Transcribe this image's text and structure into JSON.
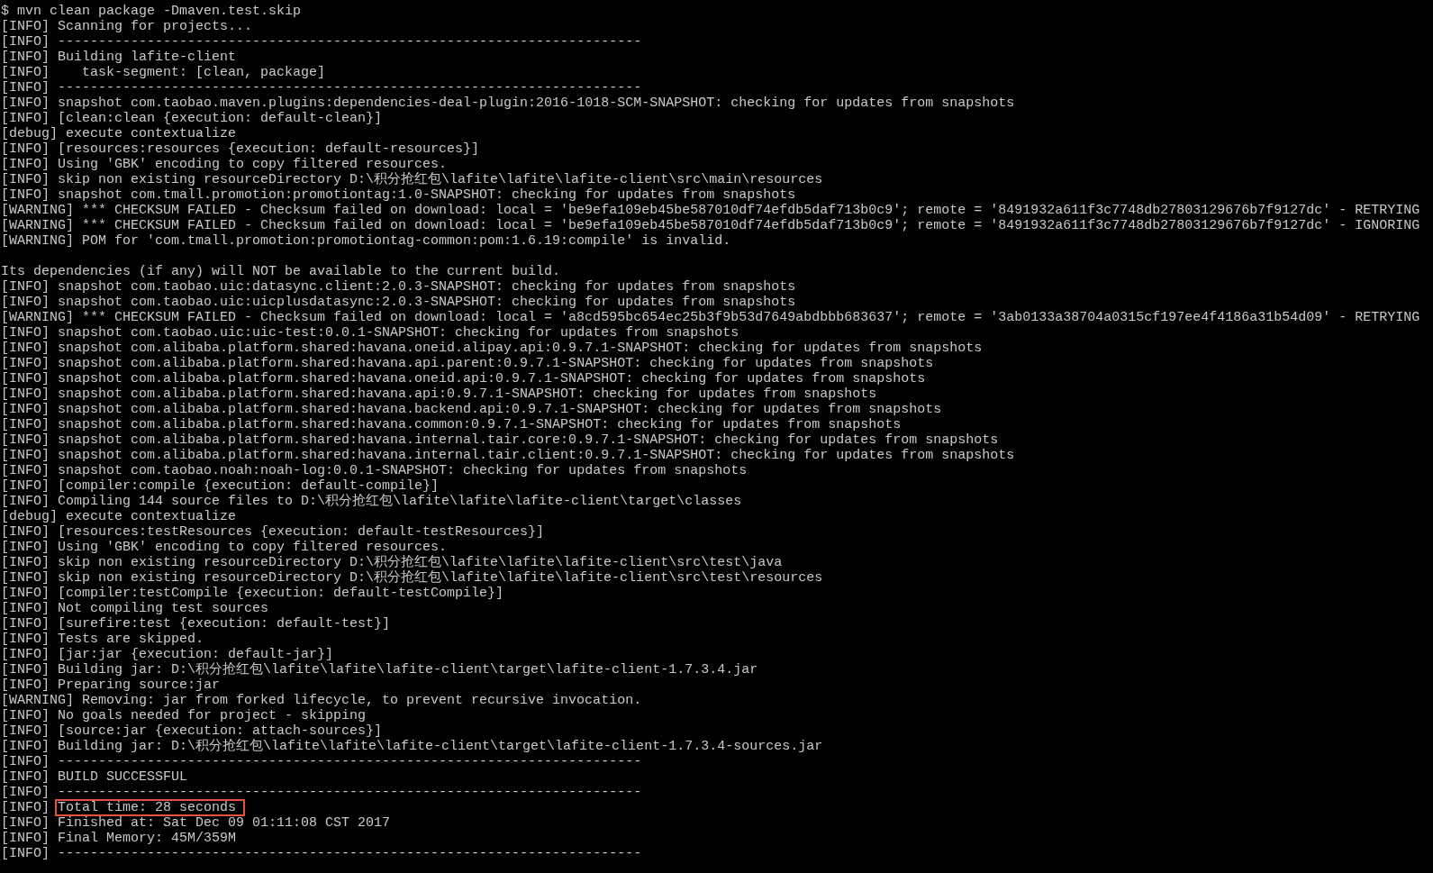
{
  "lines": [
    {
      "kind": "command",
      "text": "$ mvn clean package -Dmaven.test.skip"
    },
    {
      "kind": "log",
      "prefix": "[INFO]",
      "text": "Scanning for projects..."
    },
    {
      "kind": "log",
      "prefix": "[INFO]",
      "text": "------------------------------------------------------------------------"
    },
    {
      "kind": "log",
      "prefix": "[INFO]",
      "text": "Building lafite-client"
    },
    {
      "kind": "log",
      "prefix": "[INFO]",
      "text": "   task-segment: [clean, package]"
    },
    {
      "kind": "log",
      "prefix": "[INFO]",
      "text": "------------------------------------------------------------------------"
    },
    {
      "kind": "log",
      "prefix": "[INFO]",
      "text": "snapshot com.taobao.maven.plugins:dependencies-deal-plugin:2016-1018-SCM-SNAPSHOT: checking for updates from snapshots"
    },
    {
      "kind": "log",
      "prefix": "[INFO]",
      "text": "[clean:clean {execution: default-clean}]"
    },
    {
      "kind": "log",
      "prefix": "[debug]",
      "text": "execute contextualize"
    },
    {
      "kind": "log",
      "prefix": "[INFO]",
      "text": "[resources:resources {execution: default-resources}]"
    },
    {
      "kind": "log",
      "prefix": "[INFO]",
      "text": "Using 'GBK' encoding to copy filtered resources."
    },
    {
      "kind": "log",
      "prefix": "[INFO]",
      "text": "skip non existing resourceDirectory D:\\积分抢红包\\lafite\\lafite\\lafite-client\\src\\main\\resources"
    },
    {
      "kind": "log",
      "prefix": "[INFO]",
      "text": "snapshot com.tmall.promotion:promotiontag:1.0-SNAPSHOT: checking for updates from snapshots"
    },
    {
      "kind": "log",
      "prefix": "[WARNING]",
      "text": "*** CHECKSUM FAILED - Checksum failed on download: local = 'be9efa109eb45be587010df74efdb5daf713b0c9'; remote = '8491932a611f3c7748db27803129676b7f9127dc' - RETRYING"
    },
    {
      "kind": "log",
      "prefix": "[WARNING]",
      "text": "*** CHECKSUM FAILED - Checksum failed on download: local = 'be9efa109eb45be587010df74efdb5daf713b0c9'; remote = '8491932a611f3c7748db27803129676b7f9127dc' - IGNORING"
    },
    {
      "kind": "log",
      "prefix": "[WARNING]",
      "text": "POM for 'com.tmall.promotion:promotiontag-common:pom:1.6.19:compile' is invalid."
    },
    {
      "kind": "blank"
    },
    {
      "kind": "plain",
      "text": "Its dependencies (if any) will NOT be available to the current build."
    },
    {
      "kind": "log",
      "prefix": "[INFO]",
      "text": "snapshot com.taobao.uic:datasync.client:2.0.3-SNAPSHOT: checking for updates from snapshots"
    },
    {
      "kind": "log",
      "prefix": "[INFO]",
      "text": "snapshot com.taobao.uic:uicplusdatasync:2.0.3-SNAPSHOT: checking for updates from snapshots"
    },
    {
      "kind": "log",
      "prefix": "[WARNING]",
      "text": "*** CHECKSUM FAILED - Checksum failed on download: local = 'a8cd595bc654ec25b3f9b53d7649abdbbb683637'; remote = '3ab0133a38704a0315cf197ee4f4186a31b54d09' - RETRYING"
    },
    {
      "kind": "log",
      "prefix": "[INFO]",
      "text": "snapshot com.taobao.uic:uic-test:0.0.1-SNAPSHOT: checking for updates from snapshots"
    },
    {
      "kind": "log",
      "prefix": "[INFO]",
      "text": "snapshot com.alibaba.platform.shared:havana.oneid.alipay.api:0.9.7.1-SNAPSHOT: checking for updates from snapshots"
    },
    {
      "kind": "log",
      "prefix": "[INFO]",
      "text": "snapshot com.alibaba.platform.shared:havana.api.parent:0.9.7.1-SNAPSHOT: checking for updates from snapshots"
    },
    {
      "kind": "log",
      "prefix": "[INFO]",
      "text": "snapshot com.alibaba.platform.shared:havana.oneid.api:0.9.7.1-SNAPSHOT: checking for updates from snapshots"
    },
    {
      "kind": "log",
      "prefix": "[INFO]",
      "text": "snapshot com.alibaba.platform.shared:havana.api:0.9.7.1-SNAPSHOT: checking for updates from snapshots"
    },
    {
      "kind": "log",
      "prefix": "[INFO]",
      "text": "snapshot com.alibaba.platform.shared:havana.backend.api:0.9.7.1-SNAPSHOT: checking for updates from snapshots"
    },
    {
      "kind": "log",
      "prefix": "[INFO]",
      "text": "snapshot com.alibaba.platform.shared:havana.common:0.9.7.1-SNAPSHOT: checking for updates from snapshots"
    },
    {
      "kind": "log",
      "prefix": "[INFO]",
      "text": "snapshot com.alibaba.platform.shared:havana.internal.tair.core:0.9.7.1-SNAPSHOT: checking for updates from snapshots"
    },
    {
      "kind": "log",
      "prefix": "[INFO]",
      "text": "snapshot com.alibaba.platform.shared:havana.internal.tair.client:0.9.7.1-SNAPSHOT: checking for updates from snapshots"
    },
    {
      "kind": "log",
      "prefix": "[INFO]",
      "text": "snapshot com.taobao.noah:noah-log:0.0.1-SNAPSHOT: checking for updates from snapshots"
    },
    {
      "kind": "log",
      "prefix": "[INFO]",
      "text": "[compiler:compile {execution: default-compile}]"
    },
    {
      "kind": "log",
      "prefix": "[INFO]",
      "text": "Compiling 144 source files to D:\\积分抢红包\\lafite\\lafite\\lafite-client\\target\\classes"
    },
    {
      "kind": "log",
      "prefix": "[debug]",
      "text": "execute contextualize"
    },
    {
      "kind": "log",
      "prefix": "[INFO]",
      "text": "[resources:testResources {execution: default-testResources}]"
    },
    {
      "kind": "log",
      "prefix": "[INFO]",
      "text": "Using 'GBK' encoding to copy filtered resources."
    },
    {
      "kind": "log",
      "prefix": "[INFO]",
      "text": "skip non existing resourceDirectory D:\\积分抢红包\\lafite\\lafite\\lafite-client\\src\\test\\java"
    },
    {
      "kind": "log",
      "prefix": "[INFO]",
      "text": "skip non existing resourceDirectory D:\\积分抢红包\\lafite\\lafite\\lafite-client\\src\\test\\resources"
    },
    {
      "kind": "log",
      "prefix": "[INFO]",
      "text": "[compiler:testCompile {execution: default-testCompile}]"
    },
    {
      "kind": "log",
      "prefix": "[INFO]",
      "text": "Not compiling test sources"
    },
    {
      "kind": "log",
      "prefix": "[INFO]",
      "text": "[surefire:test {execution: default-test}]"
    },
    {
      "kind": "log",
      "prefix": "[INFO]",
      "text": "Tests are skipped."
    },
    {
      "kind": "log",
      "prefix": "[INFO]",
      "text": "[jar:jar {execution: default-jar}]"
    },
    {
      "kind": "log",
      "prefix": "[INFO]",
      "text": "Building jar: D:\\积分抢红包\\lafite\\lafite\\lafite-client\\target\\lafite-client-1.7.3.4.jar"
    },
    {
      "kind": "log",
      "prefix": "[INFO]",
      "text": "Preparing source:jar"
    },
    {
      "kind": "log",
      "prefix": "[WARNING]",
      "text": "Removing: jar from forked lifecycle, to prevent recursive invocation."
    },
    {
      "kind": "log",
      "prefix": "[INFO]",
      "text": "No goals needed for project - skipping"
    },
    {
      "kind": "log",
      "prefix": "[INFO]",
      "text": "[source:jar {execution: attach-sources}]"
    },
    {
      "kind": "log",
      "prefix": "[INFO]",
      "text": "Building jar: D:\\积分抢红包\\lafite\\lafite\\lafite-client\\target\\lafite-client-1.7.3.4-sources.jar"
    },
    {
      "kind": "log",
      "prefix": "[INFO]",
      "text": "------------------------------------------------------------------------"
    },
    {
      "kind": "log",
      "prefix": "[INFO]",
      "text": "BUILD SUCCESSFUL"
    },
    {
      "kind": "log",
      "prefix": "[INFO]",
      "text": "------------------------------------------------------------------------"
    },
    {
      "kind": "log",
      "prefix": "[INFO]",
      "text": "Total time: 28 seconds",
      "highlighted": true
    },
    {
      "kind": "log",
      "prefix": "[INFO]",
      "text": "Finished at: Sat Dec 09 01:11:08 CST 2017"
    },
    {
      "kind": "log",
      "prefix": "[INFO]",
      "text": "Final Memory: 45M/359M"
    },
    {
      "kind": "log",
      "prefix": "[INFO]",
      "text": "------------------------------------------------------------------------"
    }
  ]
}
